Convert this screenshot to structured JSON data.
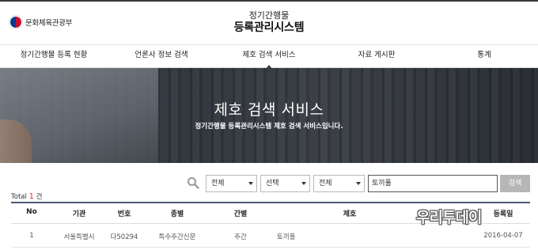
{
  "header": {
    "logo_text": "문화체육관광부",
    "title_line1": "정기간행물",
    "title_line2": "등록관리시스템"
  },
  "nav": {
    "items": [
      {
        "label": "정기간행물 등록 현황"
      },
      {
        "label": "언론사 정보 검색"
      },
      {
        "label": "제호 검색 서비스"
      },
      {
        "label": "자료 게시판"
      },
      {
        "label": "통계"
      }
    ],
    "active_index": 2
  },
  "hero": {
    "title": "제호 검색 서비스",
    "subtitle": "정기간행물 등록관리시스템 제호 검색 서비스입니다."
  },
  "search": {
    "select1_value": "전체",
    "select2_value": "선택",
    "select3_value": "전체",
    "query_value": "토끼풀",
    "button_label": "검색"
  },
  "result": {
    "total_prefix": "Total",
    "total_count": "1",
    "total_suffix": "건"
  },
  "table": {
    "headers": [
      "No",
      "기관",
      "번호",
      "종별",
      "간별",
      "제호",
      "등록일"
    ],
    "rows": [
      [
        "1",
        "서울특별시",
        "다50294",
        "특수주간신문",
        "주간",
        "토끼풀",
        "2016-04-07"
      ]
    ]
  },
  "watermark": "우리투데이",
  "colors": {
    "accent": "#4a5a75",
    "count": "#dd3333",
    "search_button": "#b6b6b6"
  }
}
